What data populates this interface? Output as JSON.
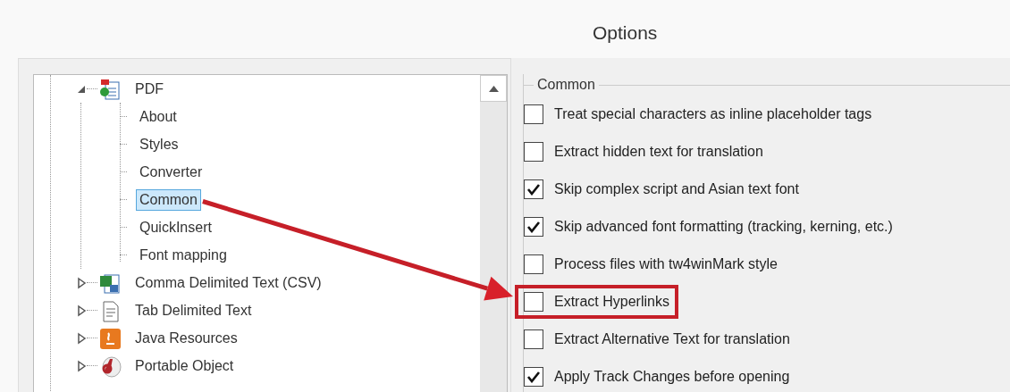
{
  "window": {
    "title": "Options"
  },
  "tree": [
    {
      "label": "PDF",
      "kind": "pdf",
      "expanded": true,
      "children": [
        {
          "label": "About",
          "selected": false
        },
        {
          "label": "Styles",
          "selected": false
        },
        {
          "label": "Converter",
          "selected": false
        },
        {
          "label": "Common",
          "selected": true
        },
        {
          "label": "QuickInsert",
          "selected": false
        },
        {
          "label": "Font mapping",
          "selected": false
        }
      ]
    },
    {
      "label": "Comma Delimited Text (CSV)",
      "kind": "csv",
      "expanded": false
    },
    {
      "label": "Tab Delimited Text",
      "kind": "text",
      "expanded": false
    },
    {
      "label": "Java Resources",
      "kind": "java",
      "expanded": false
    },
    {
      "label": "Portable Object",
      "kind": "po",
      "expanded": false
    }
  ],
  "group": {
    "title": "Common"
  },
  "options": [
    {
      "label": "Treat special characters as inline placeholder tags",
      "checked": false,
      "highlighted": false
    },
    {
      "label": "Extract hidden text for translation",
      "checked": false,
      "highlighted": false
    },
    {
      "label": "Skip complex script and Asian text font",
      "checked": true,
      "highlighted": false
    },
    {
      "label": "Skip advanced font formatting (tracking, kerning, etc.)",
      "checked": true,
      "highlighted": false
    },
    {
      "label": "Process files with tw4winMark style",
      "checked": false,
      "highlighted": false
    },
    {
      "label": "Extract Hyperlinks",
      "checked": false,
      "highlighted": true
    },
    {
      "label": "Extract Alternative Text for translation",
      "checked": false,
      "highlighted": false
    },
    {
      "label": "Apply Track Changes before opening",
      "checked": true,
      "highlighted": false
    }
  ]
}
